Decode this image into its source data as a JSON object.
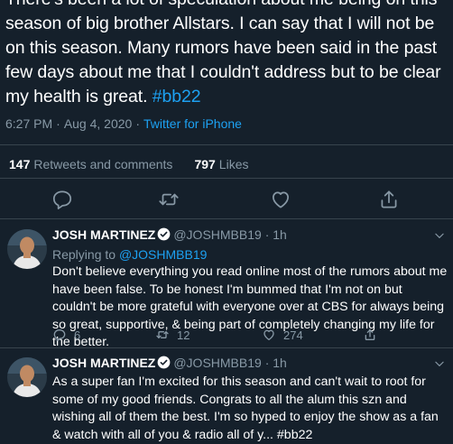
{
  "tweet": {
    "text_lines": [
      "There's been a lot of speculation about me being on this",
      "season of big brother Allstars. I can say that I will not be",
      "on this season. Many rumors have been said in the past",
      "few days about me that I couldn't address but to be clear",
      "my health is great."
    ],
    "hashtag": "#bb22",
    "time": "6:27 PM",
    "date": "Aug 4, 2020",
    "client": "Twitter for iPhone",
    "retweets_count": "147",
    "retweets_label": "Retweets and comments",
    "likes_count": "797",
    "likes_label": "Likes"
  },
  "replies": [
    {
      "display_name": "JOSH MARTINEZ",
      "handle": "@JOSHMBB19",
      "time": "1h",
      "replying_label": "Replying to",
      "replying_handle": "@JOSHMBB19",
      "text": "Don't believe everything you read online most of the rumors about me have been false. To be honest I'm bummed that I'm not on but couldn't be more grateful with everyone over at CBS for always being so great, supportive, & being part of completely changing my life for the better.",
      "replies": "6",
      "retweets": "12",
      "likes": "274"
    },
    {
      "display_name": "JOSH MARTINEZ",
      "handle": "@JOSHMBB19",
      "time": "1h",
      "text": "As a super fan I'm excited for this season and can't wait to root for some of my good friends. Congrats to all the alum this szn and wishing all of them the best. I'm so hyped to enjoy the show as a fan & watch with all of you & radio all of y... #bb22"
    }
  ],
  "icons": [
    "reply-icon",
    "retweet-icon",
    "like-icon",
    "share-icon",
    "verified-icon",
    "chevron-down-icon"
  ],
  "colors": {
    "background": "#15202b",
    "link": "#1da1f2",
    "muted": "#8899a6",
    "divider": "#38444d"
  }
}
